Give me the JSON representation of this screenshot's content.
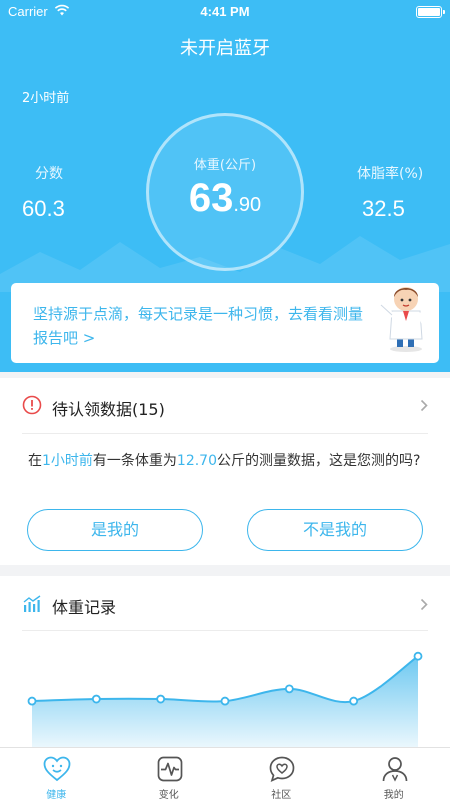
{
  "status_bar": {
    "carrier": "Carrier",
    "time": "4:41 PM"
  },
  "header": {
    "title": "未开启蓝牙",
    "last_measured": "2小时前",
    "score": {
      "label": "分数",
      "value": "60.3"
    },
    "weight": {
      "label": "体重(公斤)",
      "integer": "63",
      "decimal": ".90"
    },
    "body_fat": {
      "label": "体脂率(%)",
      "value": "32.5"
    },
    "tip": "坚持源于点滴，每天记录是一种习惯，去看看测量报告吧 >"
  },
  "pending": {
    "title": "待认领数据(15)",
    "message_prefix": "在",
    "message_time": "1小时前",
    "message_middle": "有一条体重为",
    "message_weight": "12.70",
    "message_suffix": "公斤的测量数据，这是您测的吗?",
    "yes_label": "是我的",
    "no_label": "不是我的"
  },
  "weight_record": {
    "title": "体重记录"
  },
  "chart_data": {
    "type": "area",
    "values": [
      0.46,
      0.48,
      0.48,
      0.46,
      0.58,
      0.46,
      0.9
    ],
    "color": "#3db6ec"
  },
  "tabs": [
    {
      "label": "健康",
      "icon": "heart-face-icon",
      "active": true
    },
    {
      "label": "变化",
      "icon": "pulse-icon",
      "active": false
    },
    {
      "label": "社区",
      "icon": "chat-heart-icon",
      "active": false
    },
    {
      "label": "我的",
      "icon": "user-icon",
      "active": false
    }
  ],
  "colors": {
    "brand": "#3dbdf5",
    "accent": "#3db6ec",
    "alert": "#e94b4b"
  }
}
